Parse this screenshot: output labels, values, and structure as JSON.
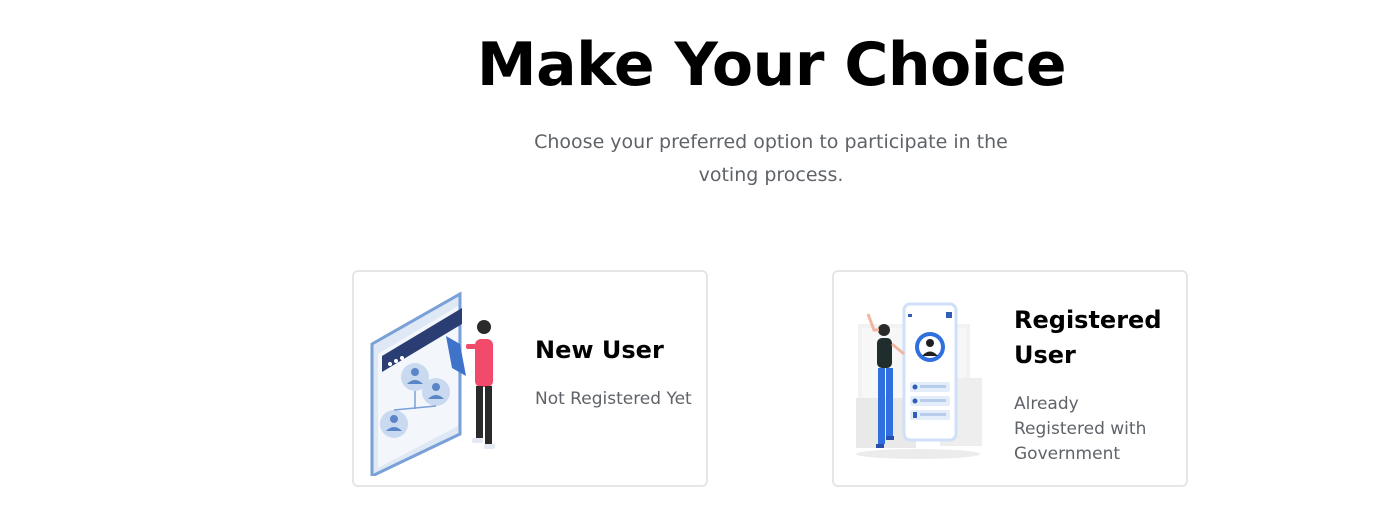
{
  "header": {
    "title": "Make Your Choice",
    "subtitle": "Choose your preferred option to participate in the voting process."
  },
  "options": [
    {
      "title": "New User",
      "description": "Not Registered Yet",
      "illustration": "person-with-voting-board-illustration"
    },
    {
      "title": "Registered User",
      "description": "Already Registered with Government",
      "illustration": "woman-with-phone-profile-illustration"
    }
  ],
  "colors": {
    "accent_blue": "#2f5fb7",
    "dark_navy": "#2b3e73",
    "person_shirt": "#f24a6b",
    "muted_text": "#5f6368",
    "card_border": "#e6e6e6"
  }
}
